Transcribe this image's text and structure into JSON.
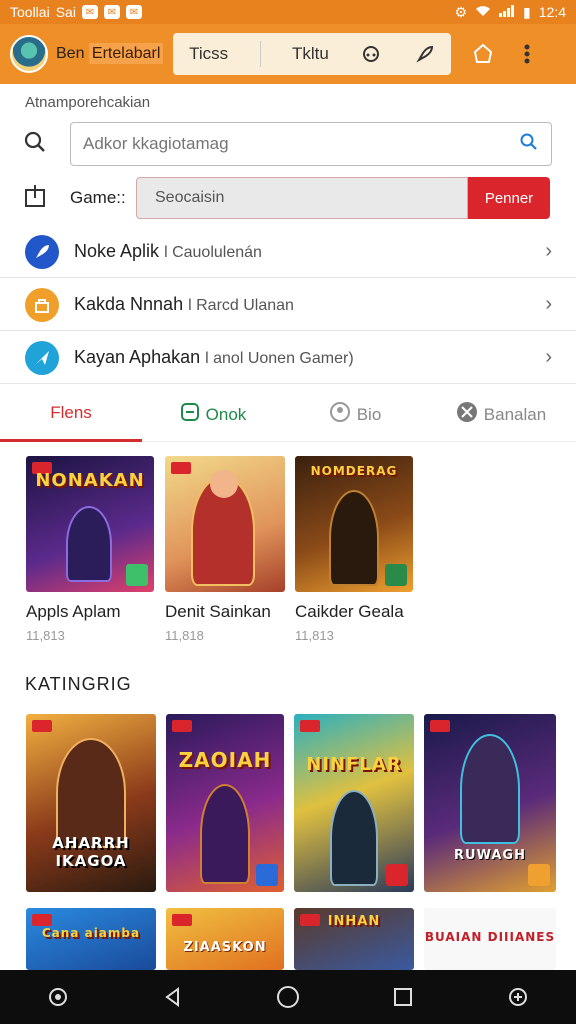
{
  "status_bar": {
    "carrier": "Toollai",
    "carrier2": "Sai",
    "time": "12:4"
  },
  "header": {
    "brand_prefix": "Ben",
    "brand_highlight": "Ertelabarl",
    "nav": [
      {
        "label": "Ticss"
      },
      {
        "label": "Tkltu"
      }
    ]
  },
  "section_title": "Atnamporehcakian",
  "search": {
    "placeholder": "Adkor kkagiotamag"
  },
  "game_row": {
    "label": "Game::",
    "value": "Seocaisin",
    "button": "Penner"
  },
  "list": [
    {
      "title": "Noke Aplik",
      "sub": "l Cauolulenán",
      "color": "#2257c9",
      "icon": "rocket-icon"
    },
    {
      "title": "Kakda Nnnah",
      "sub": "l Rarcd Ulanan",
      "color": "#f0a02a",
      "icon": "bag-icon"
    },
    {
      "title": "Kayan Aphakan",
      "sub": "l anol Uonen Gamer)",
      "color": "#1fa3d9",
      "icon": "send-icon"
    }
  ],
  "tabs": [
    {
      "label": "Flens"
    },
    {
      "label": "Onok"
    },
    {
      "label": "Bio"
    },
    {
      "label": "Banalan"
    }
  ],
  "featured": [
    {
      "name": "Appls Aplam",
      "meta": "11,813",
      "art_title": "NONAKAN",
      "bg": "#3b1f6e"
    },
    {
      "name": "Denit Sainkan",
      "meta": "11,818",
      "art_title": "",
      "bg": "#d9b36a"
    },
    {
      "name": "Caikder Geala",
      "meta": "11,813",
      "art_title": "NOMDERAG",
      "bg": "#5a3a1a"
    }
  ],
  "category_title": "KATINGRIG",
  "category": [
    {
      "art_title": "AHARRH IKAGOA",
      "bg": "#7a3b22"
    },
    {
      "art_title": "ZAOIAH",
      "bg": "#5b2a8c"
    },
    {
      "art_title": "NINFLAR",
      "bg": "#2a8a9a"
    },
    {
      "art_title": "RUWAGH",
      "bg": "#4a2a6a"
    }
  ],
  "category2": [
    {
      "art_title": "Cana aiamba",
      "bg": "#2266cc"
    },
    {
      "art_title": "ZIAASKON",
      "bg": "#e0a020"
    },
    {
      "art_title": "INHAN",
      "bg": "#3a5aa0"
    },
    {
      "art_title": "BUAIAN DIIIANES",
      "bg": "#ffffff"
    }
  ]
}
